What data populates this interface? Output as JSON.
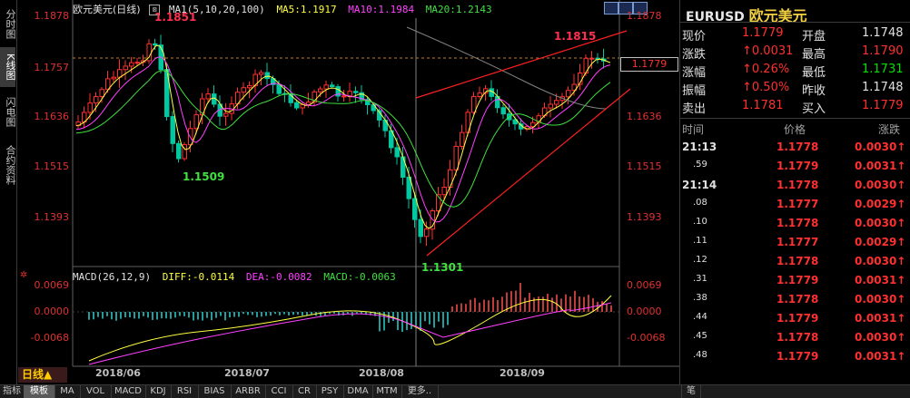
{
  "left_tabs": [
    {
      "label": "分时图",
      "active": false
    },
    {
      "label": "K线图",
      "active": true
    },
    {
      "label": "闪电图",
      "active": false
    },
    {
      "label": "合约资料",
      "active": false
    }
  ],
  "chart": {
    "title": "欧元美元(日线)",
    "ma_legend": {
      "label": "MA1(5,10,20,100)",
      "ma5": "MA5:1.1917",
      "ma10": "MA10:1.1984",
      "ma20": "MA20:1.2143"
    },
    "price_axis": [
      "1.1878",
      "1.1757",
      "1.1636",
      "1.1515",
      "1.1393"
    ],
    "price_axis_right": [
      "1.1878",
      "1.1757",
      "1.1636",
      "1.1515",
      "1.1393"
    ],
    "last_price_box": "1.1779",
    "annotations": {
      "high_left": "1.1851",
      "low_mid": "1.1509",
      "low_bottom": "1.1301",
      "high_right": "1.1815"
    },
    "macd_legend": {
      "label": "MACD(26,12,9)",
      "diff": "DIFF:-0.0114",
      "dea": "DEA:-0.0082",
      "macd": "MACD:-0.0063"
    },
    "macd_axis": [
      "0.0069",
      "0.0000",
      "-0.0068"
    ],
    "macd_axis_right": [
      "0.0069",
      "0.0000",
      "-0.0068"
    ],
    "dates": [
      "2018/06",
      "2018/07",
      "2018/08",
      "2018/09"
    ],
    "period_label": "日线▲"
  },
  "panel": {
    "symbol": "EURUSD",
    "name": "欧元美元",
    "quote_rows": [
      {
        "l1": "现价",
        "v1": "1.1779",
        "c1": "red",
        "l2": "开盘",
        "v2": "1.1748",
        "c2": "white"
      },
      {
        "l1": "涨跌",
        "v1": "↑0.0031",
        "c1": "red",
        "l2": "最高",
        "v2": "1.1790",
        "c2": "red"
      },
      {
        "l1": "涨幅",
        "v1": "↑0.26%",
        "c1": "red",
        "l2": "最低",
        "v2": "1.1731",
        "c2": "green"
      },
      {
        "l1": "振幅",
        "v1": "↑0.50%",
        "c1": "red",
        "l2": "昨收",
        "v2": "1.1748",
        "c2": "white"
      },
      {
        "l1": "卖出",
        "v1": "1.1781",
        "c1": "red",
        "l2": "买入",
        "v2": "1.1779",
        "c2": "red"
      }
    ],
    "tick_header": {
      "time": "时间",
      "price": "价格",
      "change": "涨跌"
    },
    "ticks": [
      {
        "time": "21:13",
        "price": "1.1778",
        "change": "0.0030↑",
        "bold": true
      },
      {
        "time": ".59",
        "price": "1.1779",
        "change": "0.0031↑",
        "bold": false
      },
      {
        "time": "21:14",
        "price": "1.1778",
        "change": "0.0030↑",
        "bold": true
      },
      {
        "time": ".08",
        "price": "1.1777",
        "change": "0.0029↑",
        "bold": false
      },
      {
        "time": ".10",
        "price": "1.1778",
        "change": "0.0030↑",
        "bold": false
      },
      {
        "time": ".11",
        "price": "1.1777",
        "change": "0.0029↑",
        "bold": false
      },
      {
        "time": ".12",
        "price": "1.1778",
        "change": "0.0030↑",
        "bold": false
      },
      {
        "time": ".31",
        "price": "1.1779",
        "change": "0.0031↑",
        "bold": false
      },
      {
        "time": ".38",
        "price": "1.1778",
        "change": "0.0030↑",
        "bold": false
      },
      {
        "time": ".44",
        "price": "1.1779",
        "change": "0.0031↑",
        "bold": false
      },
      {
        "time": ".45",
        "price": "1.1778",
        "change": "0.0030↑",
        "bold": false
      },
      {
        "time": ".48",
        "price": "1.1779",
        "change": "0.0031↑",
        "bold": false
      }
    ]
  },
  "toolbar": [
    {
      "label": "指标",
      "active": false
    },
    {
      "label": "模板",
      "active": true
    },
    {
      "label": "MA",
      "active": false
    },
    {
      "label": "VOL",
      "active": false
    },
    {
      "label": "MACD",
      "active": false
    },
    {
      "label": "KDJ",
      "active": false
    },
    {
      "label": "RSI",
      "active": false
    },
    {
      "label": "BIAS",
      "active": false
    },
    {
      "label": "ARBR",
      "active": false
    },
    {
      "label": "CCI",
      "active": false
    },
    {
      "label": "CR",
      "active": false
    },
    {
      "label": "PSY",
      "active": false
    },
    {
      "label": "DMA",
      "active": false
    },
    {
      "label": "MTM",
      "active": false
    },
    {
      "label": "更多..",
      "active": false
    }
  ],
  "toolbar_right": "笔",
  "colors": {
    "up": "#ff3030",
    "down": "#00c8a0",
    "ma5": "#ffff40",
    "ma10": "#ff40ff",
    "ma20": "#40e040",
    "ma100": "#808080"
  }
}
